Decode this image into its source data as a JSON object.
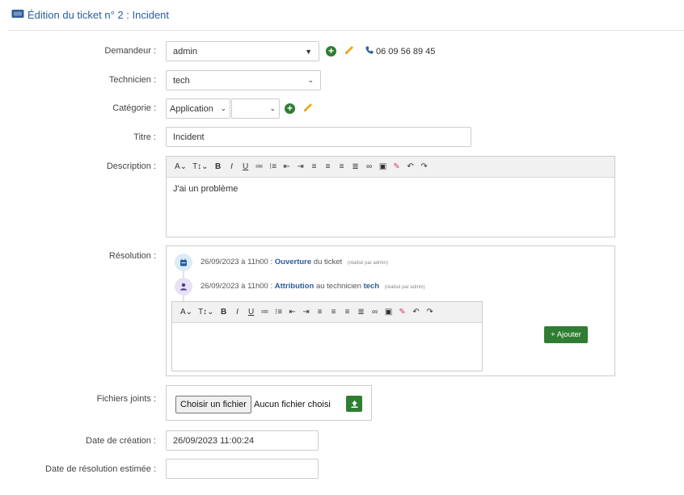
{
  "header": {
    "title": "Édition du ticket n° 2 : Incident"
  },
  "form": {
    "demandeur": {
      "label": "Demandeur :",
      "value": "admin",
      "phone": "06 09 56 89 45"
    },
    "technicien": {
      "label": "Technicien :",
      "value": "tech"
    },
    "categorie": {
      "label": "Catégorie :",
      "value": "Application",
      "sub_value": ""
    },
    "titre": {
      "label": "Titre :",
      "value": "Incident"
    },
    "description": {
      "label": "Description :",
      "value": "J'ai un problème"
    },
    "resolution": {
      "label": "Résolution :",
      "events": [
        {
          "date": "26/09/2023 à 11h00 :",
          "action": "Ouverture",
          "text": "du ticket",
          "by": "(réalisé par admin)"
        },
        {
          "date": "26/09/2023 à 11h00 :",
          "action": "Attribution",
          "text": "au technicien",
          "target": "tech",
          "by": "(réalisé par admin)"
        }
      ],
      "add_label": "Ajouter"
    },
    "fichiers": {
      "label": "Fichiers joints :",
      "choose_label": "Choisir un fichier",
      "no_file": "Aucun fichier choisi"
    },
    "date_creation": {
      "label": "Date de création :",
      "value": "26/09/2023 11:00:24"
    },
    "date_resolution": {
      "label": "Date de résolution estimée :",
      "value": ""
    }
  },
  "colors": {
    "accent": "#2b5d9b",
    "success": "#2f7d32",
    "pencil": "#f0a81c",
    "timeline_icon_1_bg": "#dcecf7",
    "timeline_icon_2_bg": "#e6e1f3"
  },
  "icons": {
    "header": "ticket-icon",
    "add": "plus-circle-icon",
    "edit": "pencil-icon",
    "phone": "phone-icon",
    "event_1": "calendar-icon",
    "event_2": "user-icon",
    "upload": "upload-icon"
  },
  "toolbar": {
    "font": "A",
    "size": "T↕",
    "bold": "B",
    "italic": "I",
    "underline": "U"
  }
}
